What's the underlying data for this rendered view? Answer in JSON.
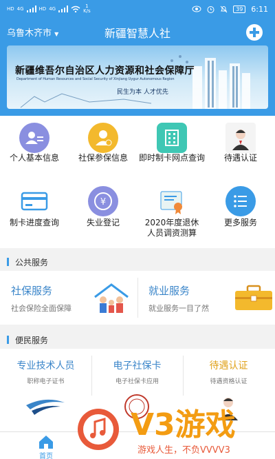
{
  "status_bar": {
    "signal_labels": [
      "HD",
      "4G",
      "HD",
      "4G"
    ],
    "net_speed_value": "1",
    "net_speed_unit": "K/s",
    "battery": "39",
    "time": "6:11"
  },
  "header": {
    "city": "乌鲁木齐市",
    "title": "新疆智慧人社",
    "add_icon": "plus-circle-icon"
  },
  "banner": {
    "title": "新疆维吾尔自治区人力资源和社会保障厅",
    "subtitle": "Department of Human Resources and Social Security of Xinjiang Uygur Autonomous Region",
    "slogan": "民生为本   人才优先"
  },
  "services": [
    {
      "label": "个人基本信息",
      "icon": "user-card-icon",
      "color": "#8a8fe0"
    },
    {
      "label": "社保参保信息",
      "icon": "insured-user-icon",
      "color": "#f3b92d"
    },
    {
      "label": "即时制卡网点查询",
      "icon": "building-icon",
      "color": "#3fc7b4"
    },
    {
      "label": "待遇认证",
      "icon": "portrait-icon",
      "color": "#e8e8e8"
    },
    {
      "label": "制卡进度查询",
      "icon": "card-icon",
      "color": "#3a9be6"
    },
    {
      "label": "失业登记",
      "icon": "yuan-refresh-icon",
      "color": "#8a8fe0"
    },
    {
      "label": "2020年度退休人员调资测算",
      "icon": "certificate-icon",
      "color": "#e8f4f3"
    },
    {
      "label": "更多服务",
      "icon": "list-icon",
      "color": "#3a9be6"
    }
  ],
  "public_services": {
    "heading": "公共服务",
    "items": [
      {
        "title": "社保服务",
        "subtitle": "社会保险全面保障",
        "icon": "family-house-icon"
      },
      {
        "title": "就业服务",
        "subtitle": "就业服务一目了然",
        "icon": "briefcase-icon"
      }
    ]
  },
  "convenient_services": {
    "heading": "便民服务",
    "items": [
      {
        "title": "专业技术人员",
        "subtitle": "职称电子证书",
        "color": "#3a85c9",
        "icon": "swoosh-logo-icon"
      },
      {
        "title": "电子社保卡",
        "subtitle": "电子社保卡应用",
        "color": "#3a85c9",
        "icon": "seal-icon"
      },
      {
        "title": "待遇认证",
        "subtitle": "待遇资格认证",
        "color": "#e0a21a",
        "icon": "portrait-icon"
      }
    ]
  },
  "bottom_nav": {
    "home_label": "首页",
    "home_icon": "home-icon"
  },
  "watermark": {
    "brand": "V3游戏",
    "slogan": "游戏人生，不负VVVV3"
  }
}
